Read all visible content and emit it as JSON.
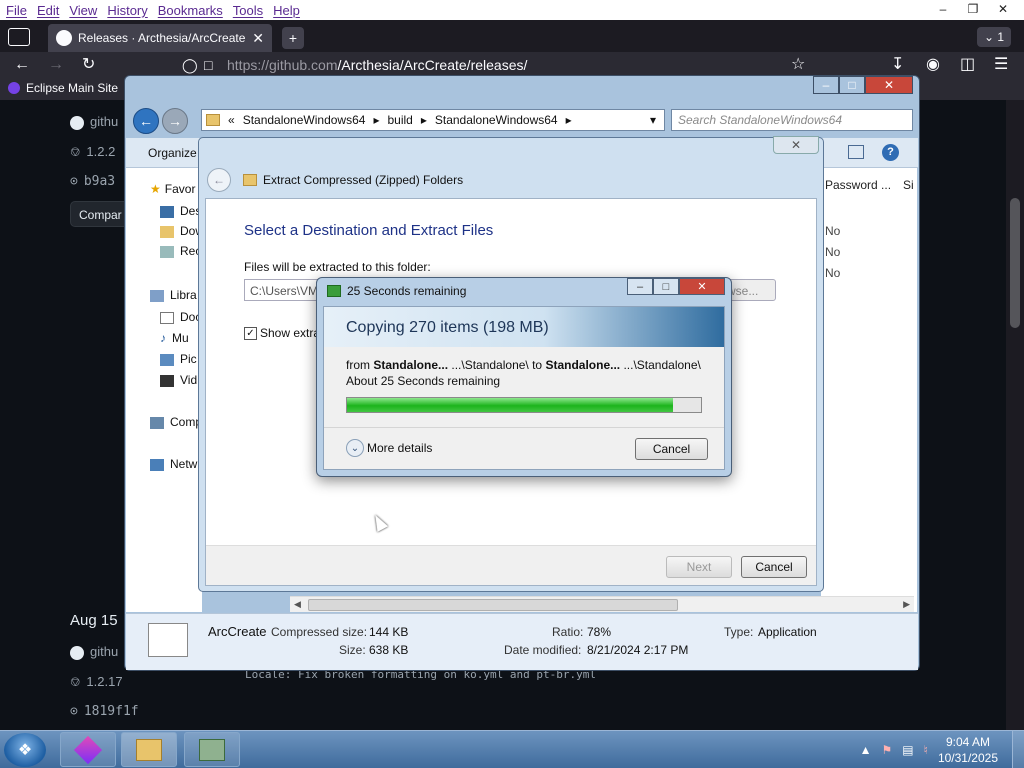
{
  "browser": {
    "menu": [
      "File",
      "Edit",
      "View",
      "History",
      "Bookmarks",
      "Tools",
      "Help"
    ],
    "tab_title": "Releases · Arcthesia/ArcCreate",
    "tab_count": "1",
    "url_host": "https://github.com",
    "url_path": "/Arcthesia/ArcCreate/releases/",
    "bookmark": "Eclipse Main Site"
  },
  "github": {
    "side_top": [
      "githu",
      "1.2.2",
      "b9a3"
    ],
    "compare_label": "Compar",
    "date": "Aug 15",
    "side_bottom": [
      "githu",
      "1.2.17",
      "1819f1f"
    ],
    "commit_line": "Locale: Fix broken formatting on ko.yml and pt-br.yml"
  },
  "explorer": {
    "path_overflow": "«",
    "path": [
      "StandaloneWindows64",
      "build",
      "StandaloneWindows64"
    ],
    "search_placeholder": "Search StandaloneWindows64",
    "organize": "Organize",
    "nav": {
      "favorites": "Favor",
      "favorites_items": [
        "Desl",
        "Dow",
        "Rec"
      ],
      "libraries": "Libra",
      "libraries_items": [
        "Doc",
        "Mu",
        "Pic",
        "Vid"
      ],
      "computer": "Comp",
      "network": "Netw"
    },
    "columns": [
      "Password ...",
      "Si"
    ],
    "rows": [
      "No",
      "No",
      "No"
    ],
    "details": {
      "name": "ArcCreate",
      "compressed_label": "Compressed size:",
      "compressed_value": "144 KB",
      "size_label": "Size:",
      "size_value": "638 KB",
      "ratio_label": "Ratio:",
      "ratio_value": "78%",
      "modified_label": "Date modified:",
      "modified_value": "8/21/2024 2:17 PM",
      "type_label": "Type:",
      "type_value": "Application"
    }
  },
  "wizard": {
    "title": "Extract Compressed (Zipped) Folders",
    "heading": "Select a Destination and Extract Files",
    "files_label": "Files will be extracted to this folder:",
    "path_value": "C:\\Users\\VM",
    "browse_label": "wse...",
    "show_label": "Show extra",
    "next_label": "Next",
    "cancel_label": "Cancel"
  },
  "copy": {
    "title": "25 Seconds remaining",
    "header": "Copying 270 items (198 MB)",
    "from_prefix": "from ",
    "from_name": "Standalone...",
    "from_path": " ...\\Standalone\\ to ",
    "to_name": "Standalone...",
    "to_path": " ...\\Standalone\\",
    "about": "About 25 Seconds remaining",
    "progress": 0.92,
    "more_details": "More details",
    "cancel_label": "Cancel"
  },
  "taskbar": {
    "time": "9:04 AM",
    "date": "10/31/2025"
  },
  "colors": {
    "progress_green": "#1cb41c",
    "github_bg": "#0d1117",
    "firefox_bg": "#1c1b22",
    "menu_text": "#5a2a91"
  }
}
